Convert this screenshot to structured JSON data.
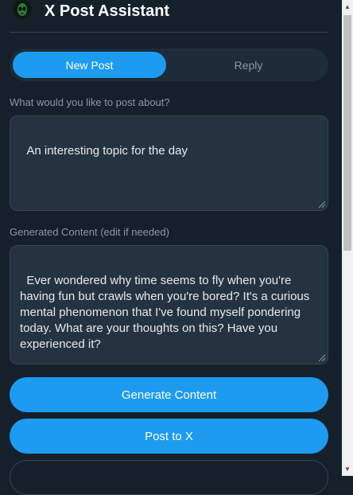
{
  "header": {
    "title": "X Post Assistant",
    "logo_icon": "alien-logo-icon"
  },
  "tabs": [
    {
      "label": "New Post",
      "active": true
    },
    {
      "label": "Reply",
      "active": false
    }
  ],
  "topic": {
    "label": "What would you like to post about?",
    "value": "An interesting topic for the day"
  },
  "generated": {
    "label": "Generated Content (edit if needed)",
    "value": "Ever wondered why time seems to fly when you're having fun but crawls when you're bored? It's a curious mental phenomenon that I've found myself pondering today. What are your thoughts on this? Have you experienced it?"
  },
  "buttons": {
    "generate_label": "Generate Content",
    "post_label": "Post to X"
  },
  "colors": {
    "background": "#15202b",
    "accent": "#1d9bf0",
    "field_bg": "#253341",
    "muted_text": "#8b98a5"
  }
}
